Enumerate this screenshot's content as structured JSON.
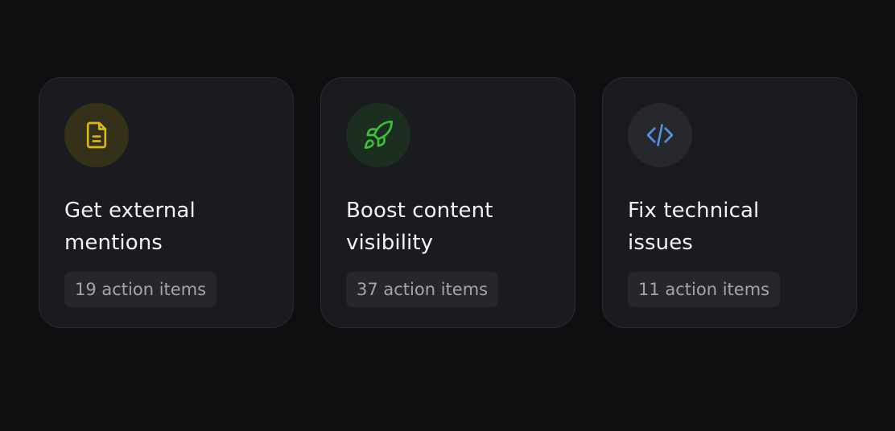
{
  "cards": [
    {
      "title": "Get external mentions",
      "badge": "19 action items",
      "icon": "document-icon",
      "icon_color": "#d4b924",
      "icon_bg": "#34301a"
    },
    {
      "title": "Boost content visibility",
      "badge": "37 action items",
      "icon": "rocket-icon",
      "icon_color": "#3cbf3a",
      "icon_bg": "#1c2e1f"
    },
    {
      "title": "Fix technical issues",
      "badge": "11 action items",
      "icon": "code-icon",
      "icon_color": "#5a8fe0",
      "icon_bg": "#26282e"
    }
  ]
}
